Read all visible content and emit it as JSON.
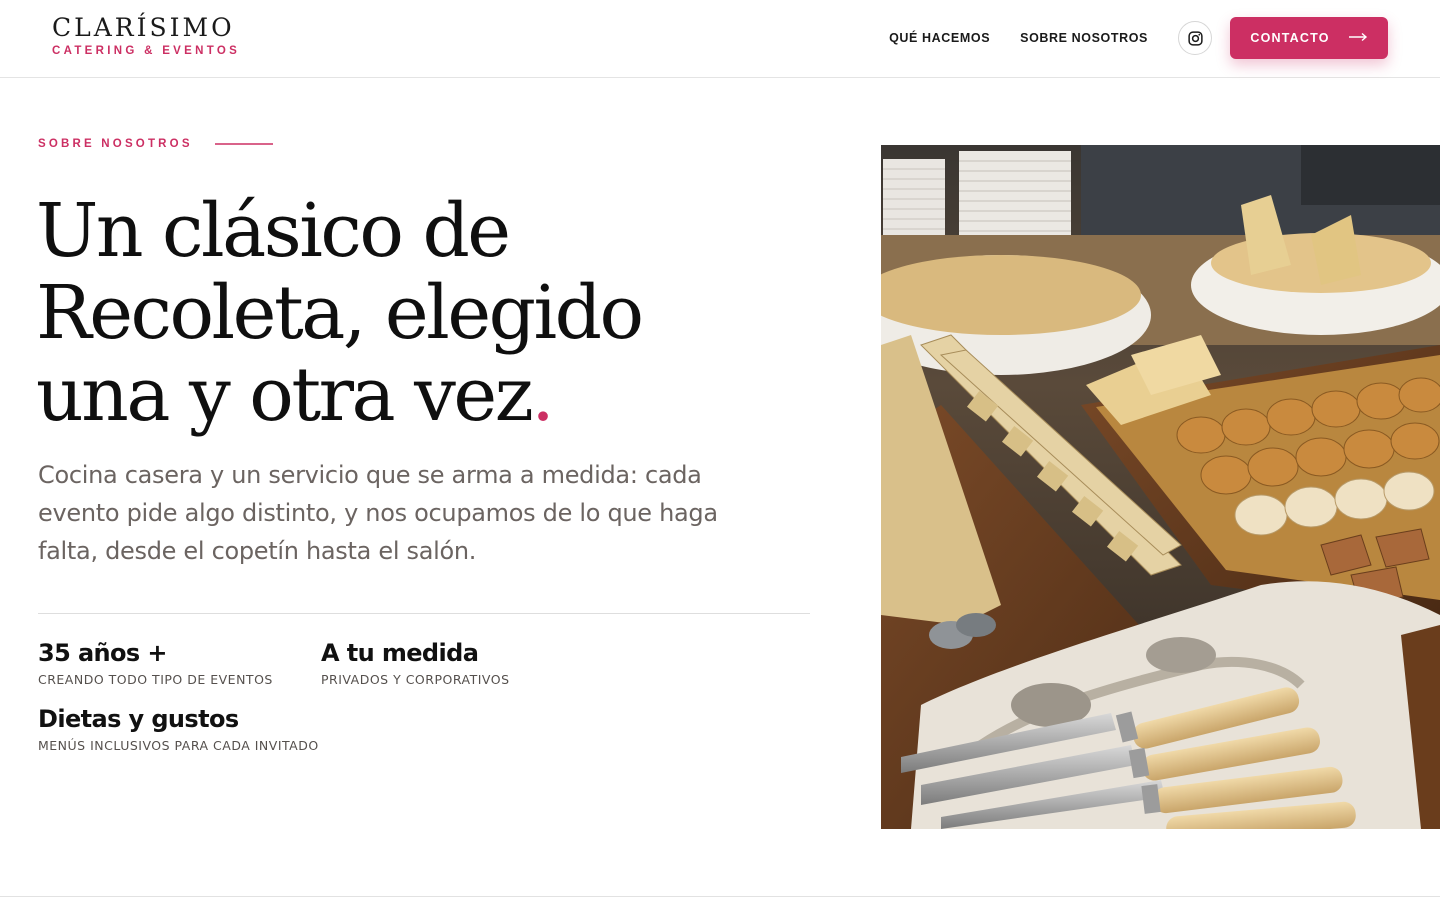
{
  "brand": {
    "name": "CLARÍSIMO",
    "tagline": "CATERING & EVENTOS",
    "accent_color": "#cc2f63"
  },
  "nav": {
    "links": [
      "QUÉ HACEMOS",
      "SOBRE NOSOTROS"
    ],
    "instagram_icon": "instagram-icon",
    "cta_label": "CONTACTO",
    "cta_icon": "arrow-right-icon"
  },
  "hero": {
    "eyebrow": "SOBRE NOSOTROS",
    "headline_lines": [
      "Un clásico de",
      "Recoleta, elegido",
      "una y otra vez"
    ],
    "headline_end": ".",
    "lead": "Cocina casera y un servicio que se arma a medida: cada evento pide algo distinto, y nos ocupamos de lo que haga falta, desde el copetín hasta el salón.",
    "stats": [
      {
        "title": "35 años +",
        "subtitle": "CREANDO TODO TIPO DE EVENTOS"
      },
      {
        "title": "A tu medida",
        "subtitle": "PRIVADOS Y CORPORATIVOS"
      },
      {
        "title": "Dietas y gustos",
        "subtitle": "MENÚS INCLUSIVOS PARA CADA INVITADO"
      }
    ]
  },
  "photo": {
    "subject": "catering buffet table with breads, sandwiches, plates and knives"
  }
}
